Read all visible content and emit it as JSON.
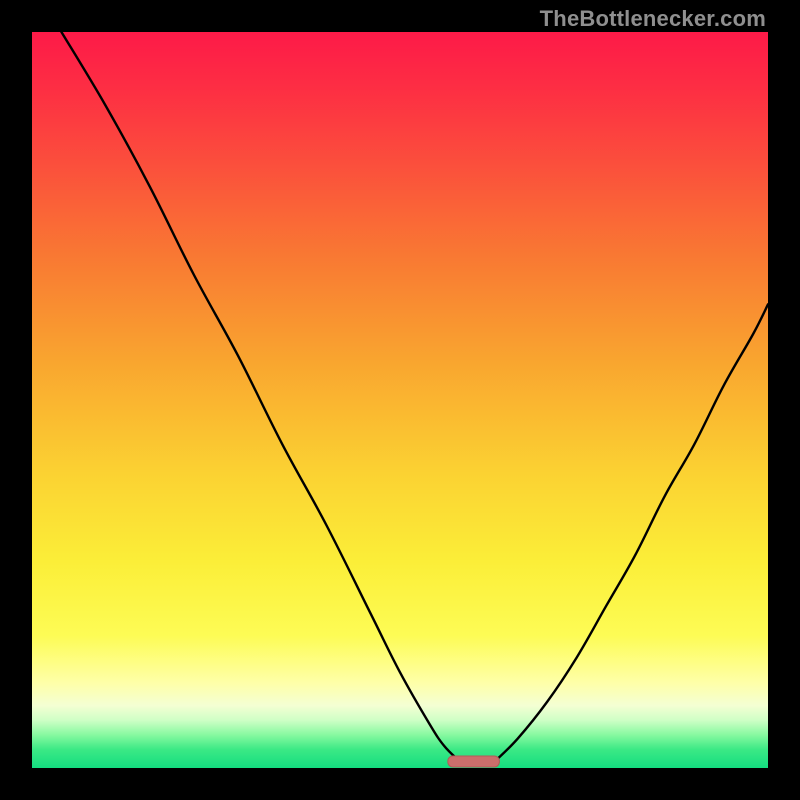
{
  "attribution": "TheBottlenecker.com",
  "colors": {
    "frame": "#000000",
    "curve": "#000000",
    "marker_fill": "#cb6e6b",
    "marker_stroke": "#b35a58",
    "gradient_stops": [
      {
        "offset": 0.0,
        "color": "#fd1a48"
      },
      {
        "offset": 0.08,
        "color": "#fd2f43"
      },
      {
        "offset": 0.18,
        "color": "#fb4f3c"
      },
      {
        "offset": 0.3,
        "color": "#f97733"
      },
      {
        "offset": 0.45,
        "color": "#f9a62f"
      },
      {
        "offset": 0.6,
        "color": "#fbd232"
      },
      {
        "offset": 0.72,
        "color": "#fbee38"
      },
      {
        "offset": 0.82,
        "color": "#fdfc55"
      },
      {
        "offset": 0.885,
        "color": "#feffa9"
      },
      {
        "offset": 0.915,
        "color": "#f4ffd3"
      },
      {
        "offset": 0.935,
        "color": "#cfffc6"
      },
      {
        "offset": 0.955,
        "color": "#87f9a0"
      },
      {
        "offset": 0.975,
        "color": "#3be985"
      },
      {
        "offset": 1.0,
        "color": "#14dd80"
      }
    ]
  },
  "chart_data": {
    "type": "line",
    "title": "",
    "xlabel": "",
    "ylabel": "",
    "xlim": [
      0,
      100
    ],
    "ylim": [
      0,
      100
    ],
    "grid": false,
    "legend": false,
    "series": [
      {
        "name": "bottleneck-curve-left",
        "x": [
          4,
          10,
          16,
          22,
          28,
          34,
          40,
          46,
          50,
          54,
          56,
          58
        ],
        "values": [
          100,
          90,
          79,
          67,
          56,
          44,
          33,
          21,
          13,
          6,
          3,
          1
        ]
      },
      {
        "name": "bottleneck-curve-right",
        "x": [
          63,
          66,
          70,
          74,
          78,
          82,
          86,
          90,
          94,
          98,
          100
        ],
        "values": [
          1,
          4,
          9,
          15,
          22,
          29,
          37,
          44,
          52,
          59,
          63
        ]
      }
    ],
    "marker": {
      "x_center": 60,
      "x_halfwidth": 3.5,
      "y": 0.5
    },
    "annotations": []
  }
}
